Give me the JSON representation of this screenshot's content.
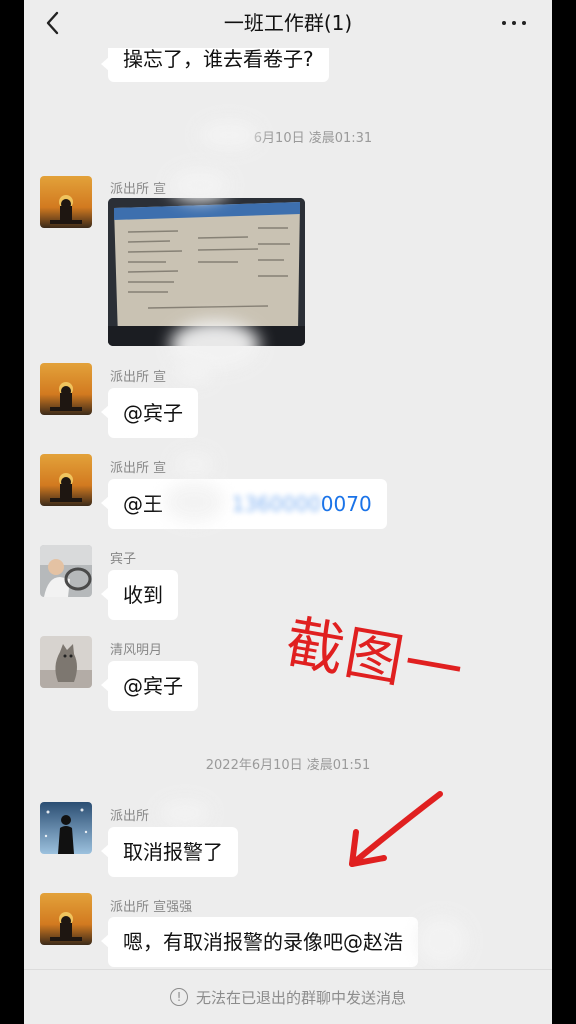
{
  "header": {
    "title": "一班工作群(1)"
  },
  "messages": [
    {
      "type": "text",
      "text": "操忘了，谁去看卷子?"
    },
    {
      "type": "timestamp",
      "text": "6月10日 凌晨01:31"
    },
    {
      "type": "image",
      "sender": "派出所 宣"
    },
    {
      "type": "text",
      "sender": "派出所 宣",
      "text": "@宾子"
    },
    {
      "type": "text",
      "sender": "派出所 宣",
      "prefix": "@王",
      "masked": "1360000",
      "suffix": "0070"
    },
    {
      "type": "text",
      "sender": "宾子",
      "text": "收到"
    },
    {
      "type": "text",
      "sender": "清风明月",
      "text": "@宾子"
    },
    {
      "type": "timestamp",
      "text": "2022年6月10日 凌晨01:51"
    },
    {
      "type": "text",
      "sender": "派出所",
      "text": "取消报警了"
    },
    {
      "type": "text",
      "sender": "派出所 宣强强",
      "text": "嗯，有取消报警的录像吧@赵浩"
    }
  ],
  "annotation": {
    "text": "截图一",
    "color": "#e02020"
  },
  "footer": {
    "notice": "无法在已退出的群聊中发送消息",
    "icon": "exclamation-circle-icon"
  },
  "colors": {
    "background": "#ededed",
    "bubble": "#ffffff",
    "link": "#1a73e8"
  }
}
